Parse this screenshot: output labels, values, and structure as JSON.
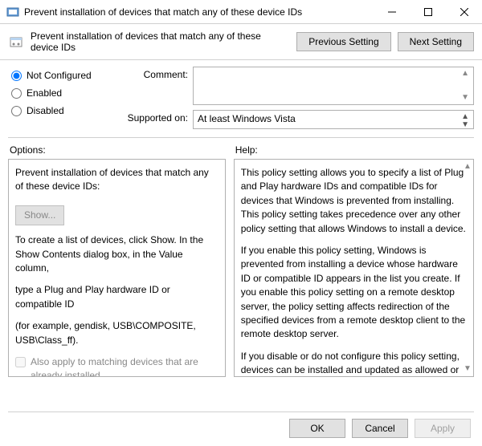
{
  "titlebar": {
    "title": "Prevent installation of devices that match any of these device IDs"
  },
  "header": {
    "title": "Prevent installation of devices that match any of these device IDs",
    "prev": "Previous Setting",
    "next": "Next Setting"
  },
  "config": {
    "not_configured": "Not Configured",
    "enabled": "Enabled",
    "disabled": "Disabled",
    "comment_label": "Comment:",
    "comment_value": "",
    "supported_label": "Supported on:",
    "supported_value": "At least Windows Vista"
  },
  "options": {
    "label": "Options:",
    "field_label": "Prevent installation of devices that match any of these device IDs:",
    "show": "Show...",
    "hint1": "To create a list of devices, click Show. In the Show Contents dialog box, in the Value column,",
    "hint2": "type a Plug and Play hardware ID or compatible ID",
    "hint3": "(for example, gendisk, USB\\COMPOSITE, USB\\Class_ff).",
    "also_apply": "Also apply to matching devices that are already installed."
  },
  "help": {
    "label": "Help:",
    "p1": "This policy setting allows you to specify a list of Plug and Play hardware IDs and compatible IDs for devices that Windows is prevented from installing. This policy setting takes precedence over any other policy setting that allows Windows to install a device.",
    "p2": "If you enable this policy setting, Windows is prevented from installing a device whose hardware ID or compatible ID appears in the list you create. If you enable this policy setting on a remote desktop server, the policy setting affects redirection of the specified devices from a remote desktop client to the remote desktop server.",
    "p3": "If you disable or do not configure this policy setting, devices can be installed and updated as allowed or prevented by other policy settings."
  },
  "footer": {
    "ok": "OK",
    "cancel": "Cancel",
    "apply": "Apply"
  }
}
